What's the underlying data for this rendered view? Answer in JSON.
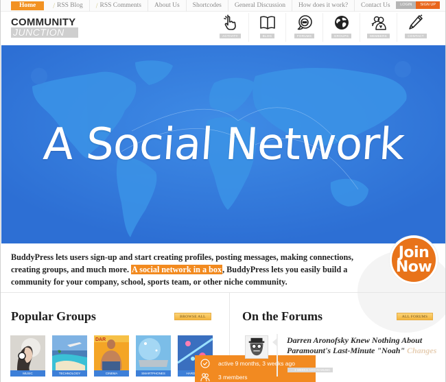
{
  "topnav": {
    "items": [
      {
        "label": "Home",
        "active": true
      },
      {
        "label": "RSS Blog",
        "rss": true
      },
      {
        "label": "RSS Comments",
        "rss": true
      },
      {
        "label": "About Us"
      },
      {
        "label": "Shortcodes"
      },
      {
        "label": "General Discussion"
      },
      {
        "label": "How does it work?"
      },
      {
        "label": "Contact Us"
      }
    ],
    "login_label": "Login",
    "signup_label": "Sign Up"
  },
  "logo": {
    "line1": "COMMUNITY",
    "line2": "JUNCTION"
  },
  "header_icons": [
    {
      "label": "Activity",
      "icon": "pointer-hand-icon"
    },
    {
      "label": "Blog",
      "icon": "book-icon"
    },
    {
      "label": "Forums",
      "icon": "chat-bubble-icon"
    },
    {
      "label": "Groups",
      "icon": "globe-icon"
    },
    {
      "label": "Members",
      "icon": "members-icon"
    },
    {
      "label": "Contact",
      "icon": "pen-icon"
    }
  ],
  "hero": {
    "title": "A Social Network"
  },
  "intro": {
    "before": "BuddyPress lets users sign-up and start creating profiles, posting messages, making connections, creating groups, and much more. ",
    "highlight": "A social network in a box",
    "after": ", BuddyPress lets you easily build a community for your company, school, sports team, or other niche community."
  },
  "join": {
    "line1": "Join",
    "line2": "Now"
  },
  "popular_groups": {
    "title": "Popular Groups",
    "browse_label": "Browse All",
    "groups": [
      {
        "label": "Music"
      },
      {
        "label": "Technology"
      },
      {
        "label": "Cinema"
      },
      {
        "label": "Smartphones"
      },
      {
        "label": "Hardware"
      }
    ],
    "tooltip": {
      "active": "active 9 months, 3 weeks ago",
      "members": "3 members"
    }
  },
  "forums": {
    "title": "On the Forums",
    "all_label": "All Forums",
    "post": {
      "title": "Darren Aronofsky Knew Nothing About Paramount's Last-Minute \"Noah\"",
      "title_faded": " Changes",
      "meta": "…, 3 weeks ago in Music"
    }
  },
  "colors": {
    "accent_orange": "#f28a21",
    "hero_blue": "#2f73d6",
    "label_blue": "#3d7fd8"
  }
}
